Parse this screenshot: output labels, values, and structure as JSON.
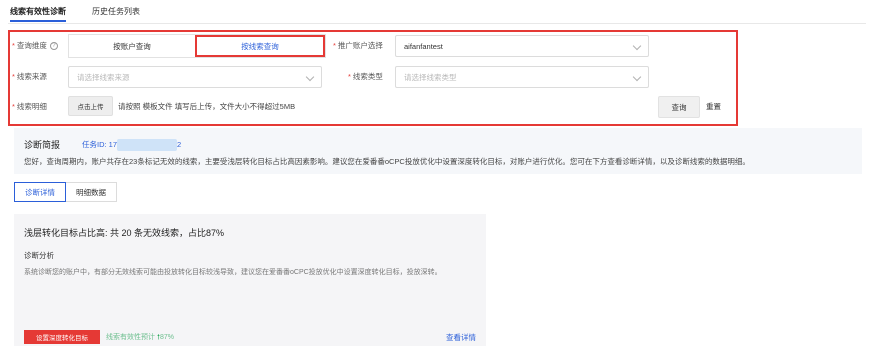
{
  "tabs": [
    {
      "label": "线索有效性诊断"
    },
    {
      "label": "历史任务列表"
    }
  ],
  "filters": {
    "query_dimension": {
      "label": "查询维度",
      "options": [
        "按账户查询",
        "按线索查询"
      ],
      "selected": "按线索查询"
    },
    "account": {
      "label": "推广账户选择",
      "value": "aifanfantest"
    },
    "source": {
      "label": "线索来源",
      "placeholder": "请选择线索来源"
    },
    "type": {
      "label": "线索类型",
      "placeholder": "请选择线索类型"
    },
    "detail": {
      "label": "线索明细",
      "upload_label": "点击上传",
      "tip_prefix": "请按照",
      "tip_link": "模板文件",
      "tip_suffix": "填写后上传，文件大小不得超过5MB"
    },
    "query_button": "查询",
    "reset_button": "重置"
  },
  "summary": {
    "title": "诊断简报",
    "task_id_prefix": "任务ID: 17",
    "task_id_suffix": "2",
    "text": "您好，查询周期内，账户共存在23条标记无效的线索，主要受浅层转化目标占比高因素影响。建议您在爱番番oCPC投放优化中设置深度转化目标，对账户进行优化。您可在下方查看诊断详情，以及诊断线索的数据明细。"
  },
  "subtabs": [
    {
      "label": "诊断详情"
    },
    {
      "label": "明细数据"
    }
  ],
  "card": {
    "title": "浅层转化目标占比高: 共 20 条无效线索，占比87%",
    "subtitle": "诊断分析",
    "description": "系统诊断您的账户中，有部分无效线索可能由投放转化目标较浅导致，建议您在爱番番oCPC投放优化中设置深度转化目标，投放深转。",
    "action_button": "设置深度转化目标",
    "metric_label": "线索有效性预计",
    "metric_value": "87%",
    "view_detail": "查看详情"
  },
  "colors": {
    "accent": "#2b5fd9",
    "highlight_border": "#e53935",
    "metric_green": "#2eaa5f"
  }
}
